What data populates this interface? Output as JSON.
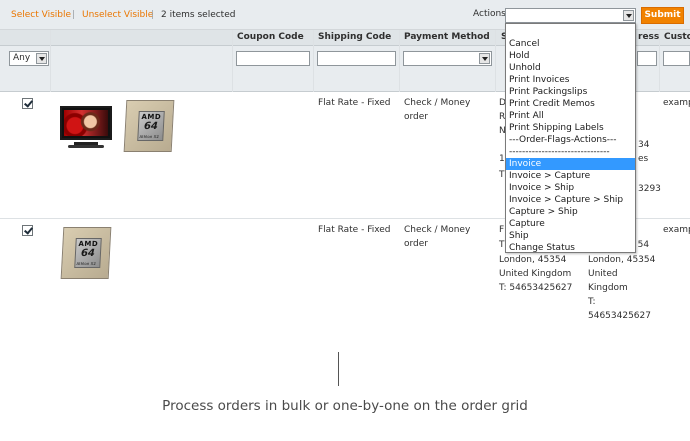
{
  "massaction": {
    "select_visible": "Select Visible",
    "separator": "|",
    "unselect_visible": "Unselect Visible",
    "separator2": "|",
    "items_selected": "2 items selected",
    "actions_label": "Actions",
    "submit_label": "Submit"
  },
  "columns": {
    "coupon_code": "Coupon Code",
    "shipping_code": "Shipping Code",
    "payment_method": "Payment Method",
    "ship_to_partial": "S",
    "address_partial": "ress",
    "customer_partial": "Custo"
  },
  "filters": {
    "any_value": "Any"
  },
  "dropdown_options": [
    "Cancel",
    "Hold",
    "Unhold",
    "Print Invoices",
    "Print Packingslips",
    "Print Credit Memos",
    "Print All",
    "Print Shipping Labels",
    "---Order-Flags-Actions---",
    "-------------------------------",
    "Invoice",
    "Invoice > Capture",
    "Invoice > Ship",
    "Invoice > Capture > Ship",
    "Capture > Ship",
    "Capture",
    "Ship",
    "Change Status"
  ],
  "dropdown_highlighted_index": 10,
  "rows": [
    {
      "shipping": "Flat Rate - Fixed",
      "payment_line1": "Check / Money",
      "payment_line2": "order",
      "shipto_fragments": [
        "D",
        "R",
        "N",
        "1",
        "T"
      ],
      "billing_fragments": [
        "34",
        "es",
        "3293"
      ],
      "customer_fragment": "examp",
      "thumbs": [
        "tv-icon",
        "cpu-icon"
      ]
    },
    {
      "shipping": "Flat Rate - Fixed",
      "payment_line1": "Check / Money",
      "payment_line2": "order",
      "shipto_lines": [
        "F",
        "T",
        "London, 45354",
        "United Kingdom",
        "T: 54653425627"
      ],
      "billing_lines": [
        "Tennet str. 54",
        "London, 45354",
        "United",
        "Kingdom",
        "T:",
        "54653425627"
      ],
      "customer_fragment": "examp",
      "thumbs": [
        "cpu-icon"
      ]
    }
  ],
  "caption": "Process orders in bulk or one-by-one on the order grid"
}
